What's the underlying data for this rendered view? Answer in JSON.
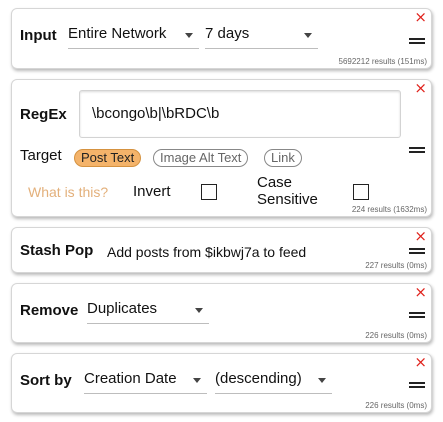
{
  "input": {
    "label": "Input",
    "network": "Entire Network",
    "period": "7 days",
    "results": "5692212 results (151ms)"
  },
  "regex": {
    "label": "RegEx",
    "value": "\\bcongo\\b|\\bRDC\\b",
    "target_label": "Target",
    "targets": [
      "Post Text",
      "Image Alt Text",
      "Link"
    ],
    "help": "What is this?",
    "invert": "Invert",
    "case_line1": "Case",
    "case_line2": "Sensitive",
    "results": "224 results (1632ms)"
  },
  "stash": {
    "label": "Stash Pop",
    "text": "Add posts from $ikbwj7a to feed",
    "results": "227 results (0ms)"
  },
  "remove": {
    "label": "Remove",
    "option": "Duplicates",
    "results": "226 results (0ms)"
  },
  "sort": {
    "label": "Sort by",
    "field": "Creation Date",
    "order": "(descending)",
    "results": "226 results (0ms)"
  },
  "icons": {
    "close": "×",
    "drag": "drag-handle-icon"
  },
  "colors": {
    "close": "#e0211b",
    "active_pill": "#f4b36a",
    "help_link": "#e3b07b"
  }
}
